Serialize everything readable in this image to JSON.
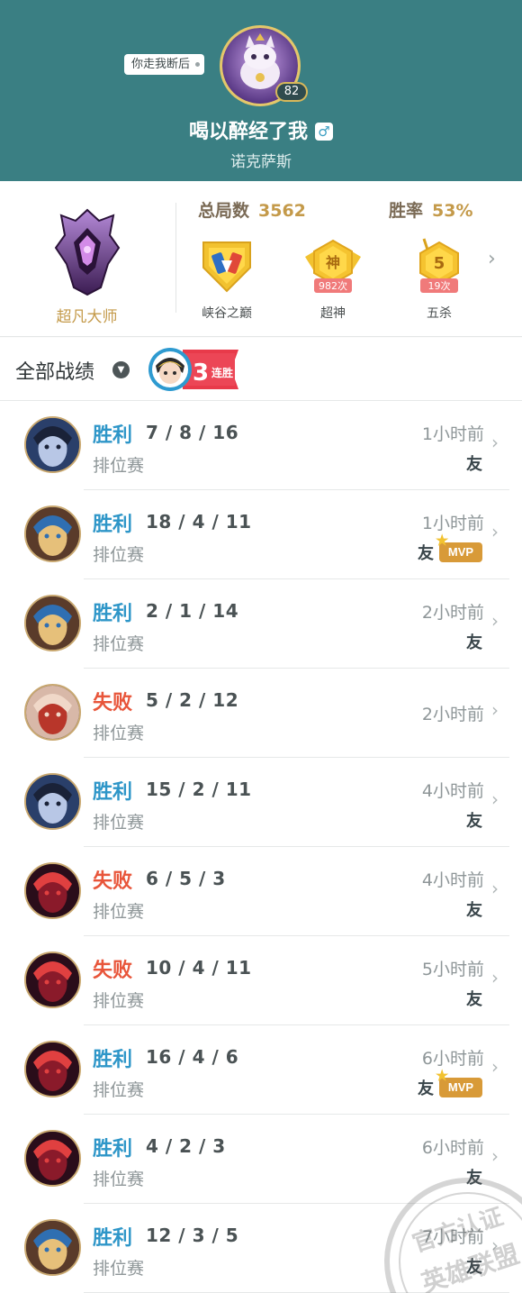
{
  "profile": {
    "tag": "你走我断后",
    "level": "82",
    "name": "喝以醉经了我",
    "gender_icon": "male-icon",
    "server": "诺克萨斯"
  },
  "stats": {
    "rank_label": "超凡大师",
    "total_label": "总局数",
    "total_value": "3562",
    "winrate_label": "胜率",
    "winrate_value": "53%",
    "badges": [
      {
        "label": "峡谷之巅",
        "icon": "summit-crest-icon",
        "count": ""
      },
      {
        "label": "超神",
        "icon": "legendary-badge-icon",
        "glyph": "神",
        "count": "982次"
      },
      {
        "label": "五杀",
        "icon": "pentakill-badge-icon",
        "glyph": "5",
        "count": "19次"
      }
    ]
  },
  "section": {
    "title": "全部战绩",
    "streak_number": "3",
    "streak_text": "连胜"
  },
  "matches": [
    {
      "result": "胜利",
      "kda": "7 / 8 / 16",
      "mode": "排位赛",
      "time": "1小时前",
      "friend": "友",
      "mvp": ""
    },
    {
      "result": "胜利",
      "kda": "18 / 4 / 11",
      "mode": "排位赛",
      "time": "1小时前",
      "friend": "友",
      "mvp": "MVP"
    },
    {
      "result": "胜利",
      "kda": "2 / 1 / 14",
      "mode": "排位赛",
      "time": "2小时前",
      "friend": "友",
      "mvp": ""
    },
    {
      "result": "失败",
      "kda": "5 / 2 / 12",
      "mode": "排位赛",
      "time": "2小时前",
      "friend": "",
      "mvp": ""
    },
    {
      "result": "胜利",
      "kda": "15 / 2 / 11",
      "mode": "排位赛",
      "time": "4小时前",
      "friend": "友",
      "mvp": ""
    },
    {
      "result": "失败",
      "kda": "6 / 5 / 3",
      "mode": "排位赛",
      "time": "4小时前",
      "friend": "友",
      "mvp": ""
    },
    {
      "result": "失败",
      "kda": "10 / 4 / 11",
      "mode": "排位赛",
      "time": "5小时前",
      "friend": "友",
      "mvp": ""
    },
    {
      "result": "胜利",
      "kda": "16 / 4 / 6",
      "mode": "排位赛",
      "time": "6小时前",
      "friend": "友",
      "mvp": "MVP"
    },
    {
      "result": "胜利",
      "kda": "4 / 2 / 3",
      "mode": "排位赛",
      "time": "6小时前",
      "friend": "友",
      "mvp": ""
    },
    {
      "result": "胜利",
      "kda": "12 / 3 / 5",
      "mode": "排位赛",
      "time": "7小时前",
      "friend": "友",
      "mvp": ""
    }
  ],
  "watermark": {
    "line1": "官方认证",
    "line2": "英雄联盟"
  },
  "colors": {
    "header": "#3a7f83",
    "win": "#2e96c8",
    "loss": "#e8553a",
    "gold": "#c49a4a"
  }
}
